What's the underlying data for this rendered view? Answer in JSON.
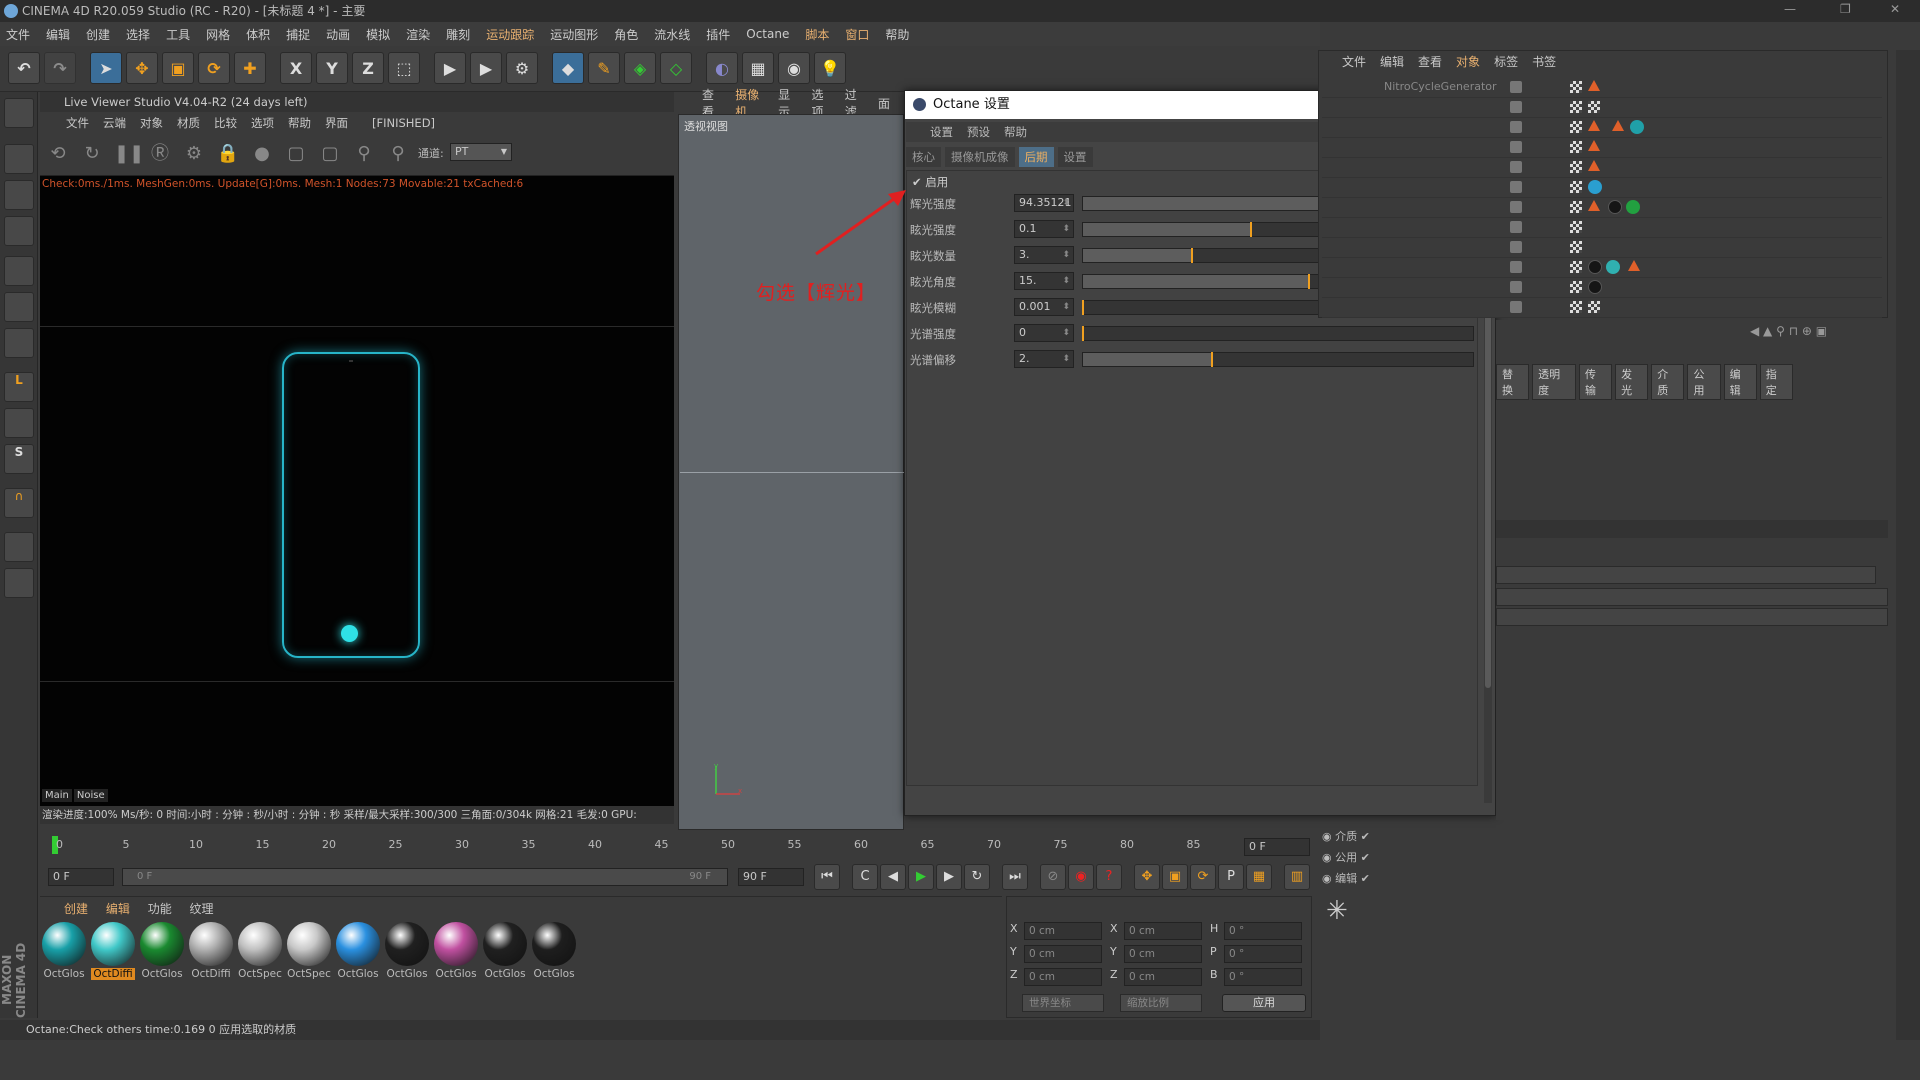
{
  "window": {
    "title": "CINEMA 4D R20.059 Studio (RC - R20) - [未标题 4 *] - 主要"
  },
  "menubar": [
    "文件",
    "编辑",
    "创建",
    "选择",
    "工具",
    "网格",
    "体积",
    "捕捉",
    "动画",
    "模拟",
    "渲染",
    "雕刻",
    "运动跟踪",
    "运动图形",
    "角色",
    "流水线",
    "插件",
    "Octane",
    "脚本",
    "窗口",
    "帮助"
  ],
  "live_viewer": {
    "title": "Live Viewer Studio V4.04-R2 (24 days left)",
    "menu": [
      "文件",
      "云端",
      "对象",
      "材质",
      "比较",
      "选项",
      "帮助",
      "界面"
    ],
    "state": "[FINISHED]",
    "channel_label": "通道:",
    "channel_value": "PT",
    "status": "Check:0ms./1ms. MeshGen:0ms. Update[G]:0ms. Mesh:1 Nodes:73 Movable:21 txCached:6",
    "tabs": [
      "Main",
      "Noise"
    ],
    "stats": "渲染进度:100%   Ms/秒: 0   时间:小时 : 分钟 : 秒/小时 : 分钟 : 秒   采样/最大采样:300/300   三角面:0/304k   网格:21  毛发:0   GPU:"
  },
  "viewport": {
    "menu": [
      "查看",
      "摄像机",
      "显示",
      "选项",
      "过滤",
      "面"
    ],
    "label": "透视视图"
  },
  "octane_settings": {
    "title": "Octane 设置",
    "menu": [
      "设置",
      "预设",
      "帮助"
    ],
    "tabs": [
      "核心",
      "摄像机成像",
      "后期",
      "设置"
    ],
    "active_tab": "后期",
    "enable_label": "启用",
    "enabled": true,
    "params": [
      {
        "label": "辉光强度",
        "value": "94.35121",
        "fraction": 0.87
      },
      {
        "label": "眩光强度",
        "value": "0.1",
        "fraction": 0.43
      },
      {
        "label": "眩光数量",
        "value": "3.",
        "fraction": 0.28
      },
      {
        "label": "眩光角度",
        "value": "15.",
        "fraction": 0.58
      },
      {
        "label": "眩光模糊",
        "value": "0.001",
        "fraction": 0.0
      },
      {
        "label": "光谱强度",
        "value": "0",
        "fraction": 0.0
      },
      {
        "label": "光谱偏移",
        "value": "2.",
        "fraction": 0.33
      }
    ],
    "annotation": "勾选【辉光】"
  },
  "object_manager": {
    "menu": [
      "文件",
      "编辑",
      "查看",
      "对象",
      "标签",
      "书签"
    ],
    "first_row": "NitroCycleGenerator"
  },
  "attributes": {
    "tabs": [
      "替换",
      "透明度",
      "传输",
      "发光",
      "介质",
      "公用",
      "编辑",
      "指定"
    ]
  },
  "timeline": {
    "ticks": [
      "0",
      "5",
      "10",
      "15",
      "20",
      "25",
      "30",
      "35",
      "40",
      "45",
      "50",
      "55",
      "60",
      "65",
      "70",
      "75",
      "80",
      "85",
      "90"
    ],
    "current_frame": "0 F",
    "start": "0 F",
    "range_start": "0 F",
    "range_end": "90 F",
    "end": "90 F"
  },
  "material_manager": {
    "menu": [
      "创建",
      "编辑",
      "功能",
      "纹理"
    ],
    "materials": [
      {
        "label": "OctGlos",
        "color": "#18a0a8"
      },
      {
        "label": "OctDiffi",
        "color": "#40c8c8",
        "selected": true
      },
      {
        "label": "OctGlos",
        "color": "#1a8a30"
      },
      {
        "label": "OctDiffi",
        "color": "#b0b0b0"
      },
      {
        "label": "OctSpec",
        "color": "#c0c0c0"
      },
      {
        "label": "OctSpec",
        "color": "#c8c8c8"
      },
      {
        "label": "OctGlos",
        "color": "#2a90e0"
      },
      {
        "label": "OctGlos",
        "color": "#202020"
      },
      {
        "label": "OctGlos",
        "color": "#c050a0"
      },
      {
        "label": "OctGlos",
        "color": "#202020"
      },
      {
        "label": "OctGlos",
        "color": "#1e1e1e"
      }
    ]
  },
  "coordinates": {
    "rows": [
      {
        "a": "X",
        "av": "0 cm",
        "b": "X",
        "bv": "0 cm",
        "c": "H",
        "cv": "0 °"
      },
      {
        "a": "Y",
        "av": "0 cm",
        "b": "Y",
        "bv": "0 cm",
        "c": "P",
        "cv": "0 °"
      },
      {
        "a": "Z",
        "av": "0 cm",
        "b": "Z",
        "bv": "0 cm",
        "c": "B",
        "cv": "0 °"
      }
    ],
    "mode1": "世界坐标",
    "mode2": "缩放比例",
    "apply": "应用"
  },
  "mini_tags": [
    "介质",
    "公用",
    "编辑"
  ],
  "statusbar": "Octane:Check others time:0.169  0      应用选取的材质"
}
